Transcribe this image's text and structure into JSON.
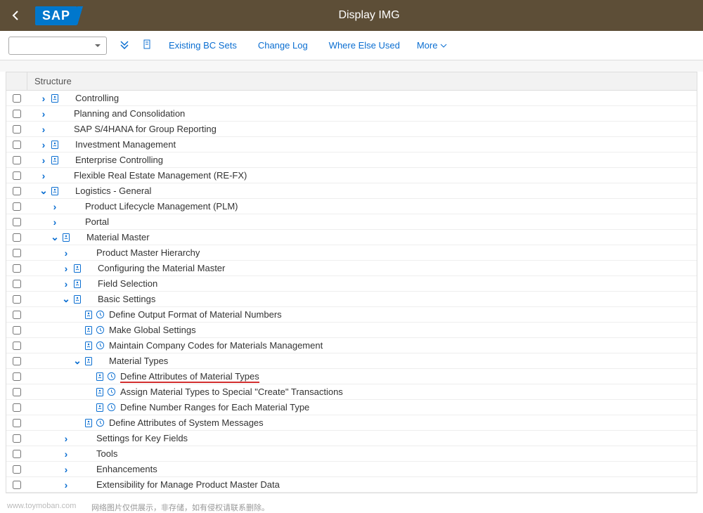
{
  "header": {
    "title": "Display IMG",
    "logo": "SAP"
  },
  "toolbar": {
    "existing_bc_sets": "Existing BC Sets",
    "change_log": "Change Log",
    "where_else_used": "Where Else Used",
    "more": "More"
  },
  "grid": {
    "header": "Structure"
  },
  "rows": [
    {
      "indent": 0,
      "chevron": "collapsed",
      "doc": true,
      "clock": false,
      "label": "Controlling"
    },
    {
      "indent": 0,
      "chevron": "collapsed",
      "doc": false,
      "clock": false,
      "label": "Planning and Consolidation"
    },
    {
      "indent": 0,
      "chevron": "collapsed",
      "doc": false,
      "clock": false,
      "label": "SAP S/4HANA for Group Reporting"
    },
    {
      "indent": 0,
      "chevron": "collapsed",
      "doc": true,
      "clock": false,
      "label": "Investment Management"
    },
    {
      "indent": 0,
      "chevron": "collapsed",
      "doc": true,
      "clock": false,
      "label": "Enterprise Controlling"
    },
    {
      "indent": 0,
      "chevron": "collapsed",
      "doc": false,
      "clock": false,
      "label": "Flexible Real Estate Management (RE-FX)"
    },
    {
      "indent": 0,
      "chevron": "expanded",
      "doc": true,
      "clock": false,
      "label": "Logistics - General"
    },
    {
      "indent": 1,
      "chevron": "collapsed",
      "doc": false,
      "clock": false,
      "label": "Product Lifecycle Management (PLM)"
    },
    {
      "indent": 1,
      "chevron": "collapsed",
      "doc": false,
      "clock": false,
      "label": "Portal"
    },
    {
      "indent": 1,
      "chevron": "expanded",
      "doc": true,
      "clock": false,
      "label": "Material Master"
    },
    {
      "indent": 2,
      "chevron": "collapsed",
      "doc": false,
      "clock": false,
      "label": "Product Master Hierarchy"
    },
    {
      "indent": 2,
      "chevron": "collapsed",
      "doc": true,
      "clock": false,
      "label": "Configuring the Material Master"
    },
    {
      "indent": 2,
      "chevron": "collapsed",
      "doc": true,
      "clock": false,
      "label": "Field Selection"
    },
    {
      "indent": 2,
      "chevron": "expanded",
      "doc": true,
      "clock": false,
      "label": "Basic Settings"
    },
    {
      "indent": 3,
      "chevron": "none",
      "doc": true,
      "clock": true,
      "label": "Define Output Format of Material Numbers"
    },
    {
      "indent": 3,
      "chevron": "none",
      "doc": true,
      "clock": true,
      "label": "Make Global Settings"
    },
    {
      "indent": 3,
      "chevron": "none",
      "doc": true,
      "clock": true,
      "label": "Maintain Company Codes for Materials Management"
    },
    {
      "indent": 3,
      "chevron": "expanded",
      "doc": true,
      "clock": false,
      "label": "Material Types"
    },
    {
      "indent": 4,
      "chevron": "none",
      "doc": true,
      "clock": true,
      "label": "Define Attributes of Material Types",
      "highlight": true
    },
    {
      "indent": 4,
      "chevron": "none",
      "doc": true,
      "clock": true,
      "label": "Assign Material Types to Special \"Create\" Transactions"
    },
    {
      "indent": 4,
      "chevron": "none",
      "doc": true,
      "clock": true,
      "label": "Define Number Ranges for Each Material Type"
    },
    {
      "indent": 3,
      "chevron": "none",
      "doc": true,
      "clock": true,
      "label": "Define Attributes of System Messages"
    },
    {
      "indent": 2,
      "chevron": "collapsed",
      "doc": false,
      "clock": false,
      "label": "Settings for Key Fields"
    },
    {
      "indent": 2,
      "chevron": "collapsed",
      "doc": false,
      "clock": false,
      "label": "Tools"
    },
    {
      "indent": 2,
      "chevron": "collapsed",
      "doc": false,
      "clock": false,
      "label": "Enhancements"
    },
    {
      "indent": 2,
      "chevron": "collapsed",
      "doc": false,
      "clock": false,
      "label": "Extensibility for Manage Product Master Data"
    }
  ],
  "watermark": "www.toymoban.com",
  "footer_note": "网络图片仅供展示，非存储，如有侵权请联系删除。"
}
